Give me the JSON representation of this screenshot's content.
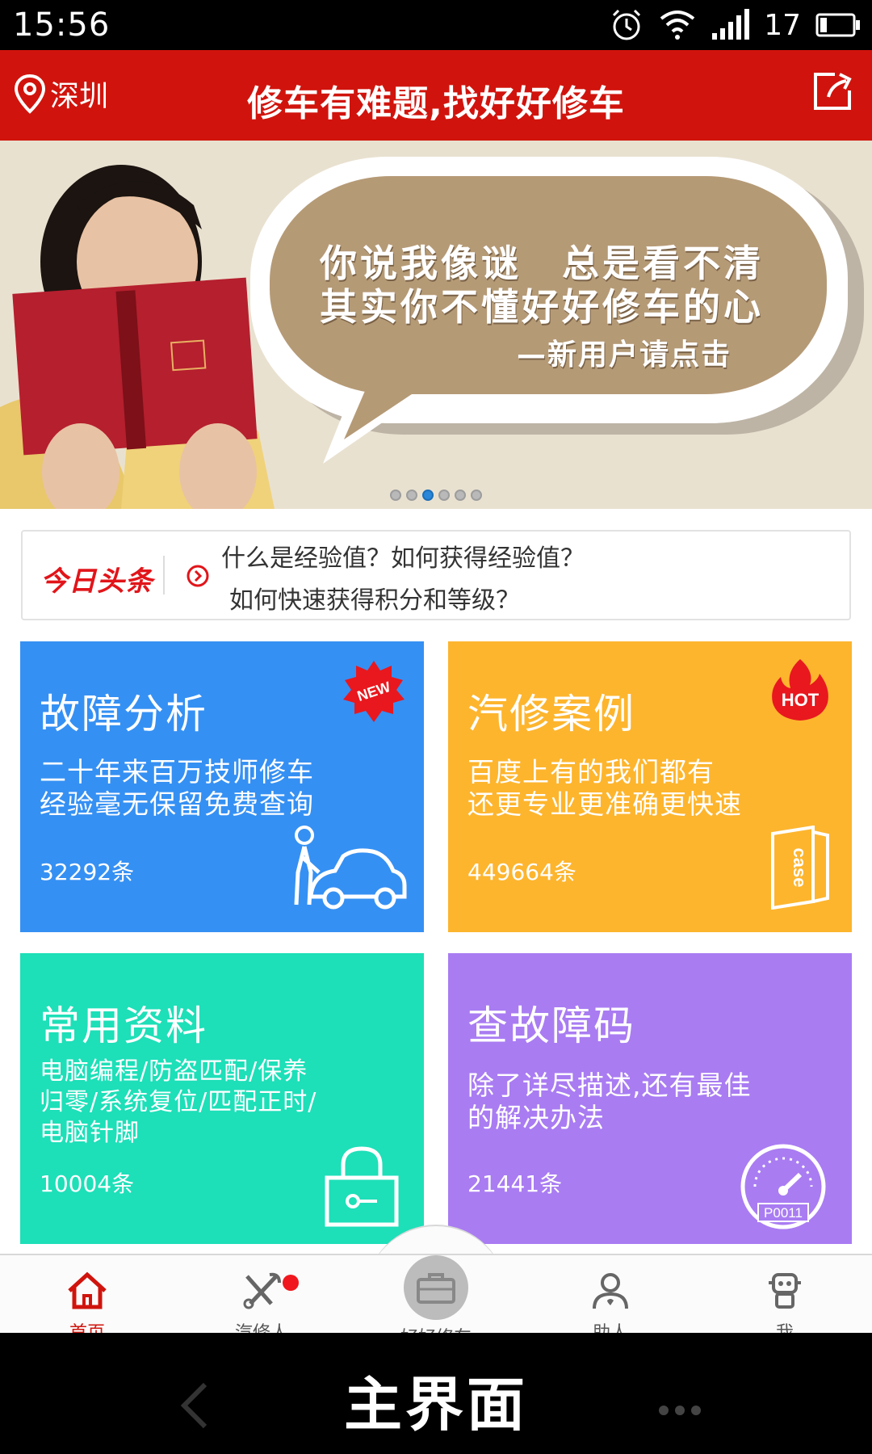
{
  "status_bar": {
    "time": "15:56",
    "battery": "17"
  },
  "header": {
    "location": "深圳",
    "title": "修车有难题,找好好修车"
  },
  "banner": {
    "line1": "你说我像谜　总是看不清",
    "line2": "其实你不懂好好修车的心",
    "line3": "—新用户请点击",
    "dots_total": 6,
    "dots_active": 3
  },
  "news": {
    "logo": "今日头条",
    "item1": "什么是经验值？如何获得经验值？",
    "item2": "如何快速获得积分和等级？"
  },
  "tiles": [
    {
      "title": "故障分析",
      "desc": "二十年来百万技师修车\n经验毫无保留免费查询",
      "count": "32292条",
      "badge": "NEW"
    },
    {
      "title": "汽修案例",
      "desc": "百度上有的我们都有\n还更专业更准确更快速",
      "count": "449664条",
      "badge": "HOT",
      "illus_text": "case"
    },
    {
      "title": "常用资料",
      "desc": "电脑编程/防盗匹配/保养\n归零/系统复位/匹配正时/\n电脑针脚",
      "count": "10004条"
    },
    {
      "title": "查故障码",
      "desc": "除了详尽描述,还有最佳\n的解决办法",
      "count": "21441条",
      "illus_text": "P0011"
    }
  ],
  "nav": {
    "home": "首页",
    "repairman": "汽修人",
    "center": "好好修车",
    "helper": "助人",
    "me": "我"
  },
  "caption": {
    "text": "主界面"
  },
  "colors": {
    "brand_red": "#d0140d",
    "tile_blue": "#3590f3",
    "tile_yellow": "#fdb52e",
    "tile_green": "#1ddfb8",
    "tile_purple": "#a97cf2"
  }
}
